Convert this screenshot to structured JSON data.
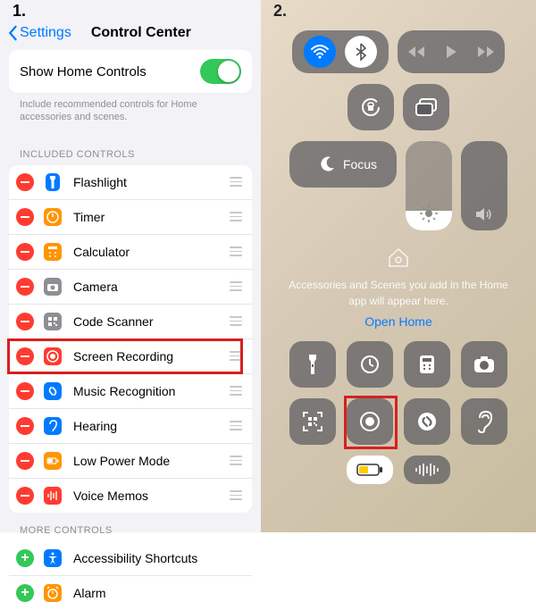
{
  "steps": {
    "one": "1.",
    "two": "2."
  },
  "nav": {
    "back": "Settings",
    "title": "Control Center"
  },
  "home_controls": {
    "label": "Show Home Controls",
    "help": "Include recommended controls for Home accessories and scenes."
  },
  "sections": {
    "included": "INCLUDED CONTROLS",
    "more": "MORE CONTROLS"
  },
  "included": [
    {
      "name": "Flashlight",
      "icon": "flashlight",
      "color": "#007aff"
    },
    {
      "name": "Timer",
      "icon": "timer",
      "color": "#ff9500"
    },
    {
      "name": "Calculator",
      "icon": "calculator",
      "color": "#ff9500"
    },
    {
      "name": "Camera",
      "icon": "camera",
      "color": "#8e8e93"
    },
    {
      "name": "Code Scanner",
      "icon": "qr",
      "color": "#8e8e93"
    },
    {
      "name": "Screen Recording",
      "icon": "record",
      "color": "#ff3b30",
      "highlighted": true
    },
    {
      "name": "Music Recognition",
      "icon": "shazam",
      "color": "#007aff"
    },
    {
      "name": "Hearing",
      "icon": "ear",
      "color": "#007aff"
    },
    {
      "name": "Low Power Mode",
      "icon": "battery",
      "color": "#ff9500"
    },
    {
      "name": "Voice Memos",
      "icon": "wave",
      "color": "#ff3b30"
    }
  ],
  "more": [
    {
      "name": "Accessibility Shortcuts",
      "icon": "access",
      "color": "#007aff"
    },
    {
      "name": "Alarm",
      "icon": "alarm",
      "color": "#ff9500"
    }
  ],
  "cc": {
    "focus": "Focus",
    "home_label": "Accessories and Scenes you add in the Home app will appear here.",
    "open_home": "Open Home"
  }
}
